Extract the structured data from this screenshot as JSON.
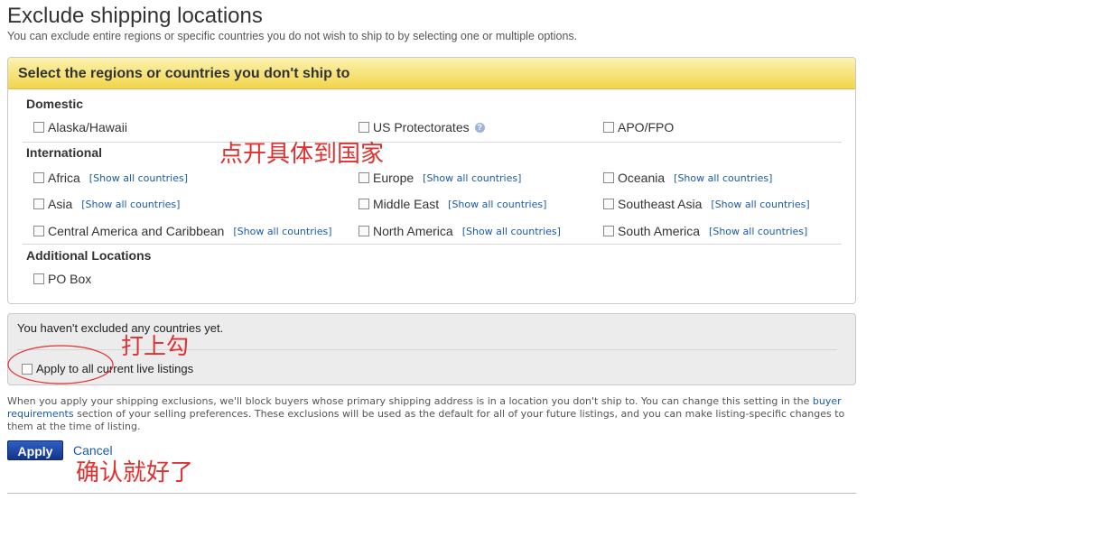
{
  "page": {
    "title": "Exclude shipping locations",
    "subtitle": "You can exclude entire regions or specific countries you do not wish to ship to by selecting one or multiple options."
  },
  "panel": {
    "header": "Select the regions or countries you don't ship to",
    "show_all_label": "[Show all countries]",
    "domestic": {
      "title": "Domestic",
      "items": [
        "Alaska/Hawaii",
        "US Protectorates",
        "APO/FPO"
      ],
      "help_icon": "question-icon"
    },
    "international": {
      "title": "International",
      "items": [
        "Africa",
        "Europe",
        "Oceania",
        "Asia",
        "Middle East",
        "Southeast Asia",
        "Central America and Caribbean",
        "North America",
        "South America"
      ]
    },
    "additional": {
      "title": "Additional Locations",
      "items": [
        "PO Box"
      ]
    }
  },
  "status": {
    "message": "You haven't excluded any countries yet.",
    "apply_all_label": "Apply to all current live listings"
  },
  "note": {
    "before_link": "When you apply your shipping exclusions, we'll block buyers whose primary shipping address is in a location you don't ship to. You can change this setting in the ",
    "link": "buyer requirements",
    "after_link": " section of your selling preferences. These exclusions will be used as the default for all of your future listings, and you can make listing-specific changes to them at the time of listing."
  },
  "actions": {
    "apply": "Apply",
    "cancel": "Cancel"
  },
  "annotations": {
    "expand_countries": "点开具体到国家",
    "check_box": "打上勾",
    "confirm": "确认就好了",
    "color": "#e03030"
  },
  "colors": {
    "link": "#1b5ba8",
    "header_gradient_top": "#fbf3b2",
    "header_gradient_bottom": "#f2d54a",
    "apply_button": "#1e45a8"
  }
}
